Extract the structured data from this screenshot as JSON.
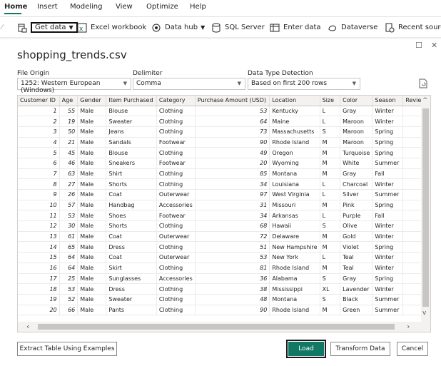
{
  "ribbon": {
    "menu": [
      "Home",
      "Insert",
      "Modeling",
      "View",
      "Optimize",
      "Help"
    ],
    "toolbar": {
      "get_data": "Get data",
      "excel": "Excel workbook",
      "data_hub": "Data hub",
      "sql": "SQL Server",
      "enter_data": "Enter data",
      "dataverse": "Dataverse",
      "recent": "Recent source"
    }
  },
  "dialog": {
    "title": "shopping_trends.csv",
    "file_origin_label": "File Origin",
    "file_origin_value": "1252: Western European (Windows)",
    "delimiter_label": "Delimiter",
    "delimiter_value": "Comma",
    "detection_label": "Data Type Detection",
    "detection_value": "Based on first 200 rows",
    "extract_btn": "Extract Table Using Examples",
    "load_btn": "Load",
    "transform_btn": "Transform Data",
    "cancel_btn": "Cancel"
  },
  "table": {
    "columns": [
      "Customer ID",
      "Age",
      "Gender",
      "Item Purchased",
      "Category",
      "Purchase Amount (USD)",
      "Location",
      "Size",
      "Color",
      "Season",
      "Review"
    ],
    "rows": [
      [
        "1",
        "55",
        "Male",
        "Blouse",
        "Clothing",
        "53",
        "Kentucky",
        "L",
        "Gray",
        "Winter"
      ],
      [
        "2",
        "19",
        "Male",
        "Sweater",
        "Clothing",
        "64",
        "Maine",
        "L",
        "Maroon",
        "Winter"
      ],
      [
        "3",
        "50",
        "Male",
        "Jeans",
        "Clothing",
        "73",
        "Massachusetts",
        "S",
        "Maroon",
        "Spring"
      ],
      [
        "4",
        "21",
        "Male",
        "Sandals",
        "Footwear",
        "90",
        "Rhode Island",
        "M",
        "Maroon",
        "Spring"
      ],
      [
        "5",
        "45",
        "Male",
        "Blouse",
        "Clothing",
        "49",
        "Oregon",
        "M",
        "Turquoise",
        "Spring"
      ],
      [
        "6",
        "46",
        "Male",
        "Sneakers",
        "Footwear",
        "20",
        "Wyoming",
        "M",
        "White",
        "Summer"
      ],
      [
        "7",
        "63",
        "Male",
        "Shirt",
        "Clothing",
        "85",
        "Montana",
        "M",
        "Gray",
        "Fall"
      ],
      [
        "8",
        "27",
        "Male",
        "Shorts",
        "Clothing",
        "34",
        "Louisiana",
        "L",
        "Charcoal",
        "Winter"
      ],
      [
        "9",
        "26",
        "Male",
        "Coat",
        "Outerwear",
        "97",
        "West Virginia",
        "L",
        "Silver",
        "Summer"
      ],
      [
        "10",
        "57",
        "Male",
        "Handbag",
        "Accessories",
        "31",
        "Missouri",
        "M",
        "Pink",
        "Spring"
      ],
      [
        "11",
        "53",
        "Male",
        "Shoes",
        "Footwear",
        "34",
        "Arkansas",
        "L",
        "Purple",
        "Fall"
      ],
      [
        "12",
        "30",
        "Male",
        "Shorts",
        "Clothing",
        "68",
        "Hawaii",
        "S",
        "Olive",
        "Winter"
      ],
      [
        "13",
        "61",
        "Male",
        "Coat",
        "Outerwear",
        "72",
        "Delaware",
        "M",
        "Gold",
        "Winter"
      ],
      [
        "14",
        "65",
        "Male",
        "Dress",
        "Clothing",
        "51",
        "New Hampshire",
        "M",
        "Violet",
        "Spring"
      ],
      [
        "15",
        "64",
        "Male",
        "Coat",
        "Outerwear",
        "53",
        "New York",
        "L",
        "Teal",
        "Winter"
      ],
      [
        "16",
        "64",
        "Male",
        "Skirt",
        "Clothing",
        "81",
        "Rhode Island",
        "M",
        "Teal",
        "Winter"
      ],
      [
        "17",
        "25",
        "Male",
        "Sunglasses",
        "Accessories",
        "36",
        "Alabama",
        "S",
        "Gray",
        "Spring"
      ],
      [
        "18",
        "53",
        "Male",
        "Dress",
        "Clothing",
        "38",
        "Mississippi",
        "XL",
        "Lavender",
        "Winter"
      ],
      [
        "19",
        "52",
        "Male",
        "Sweater",
        "Clothing",
        "48",
        "Montana",
        "S",
        "Black",
        "Summer"
      ],
      [
        "20",
        "66",
        "Male",
        "Pants",
        "Clothing",
        "90",
        "Rhode Island",
        "M",
        "Green",
        "Summer"
      ]
    ]
  },
  "colors": {
    "accent": "#117865"
  }
}
